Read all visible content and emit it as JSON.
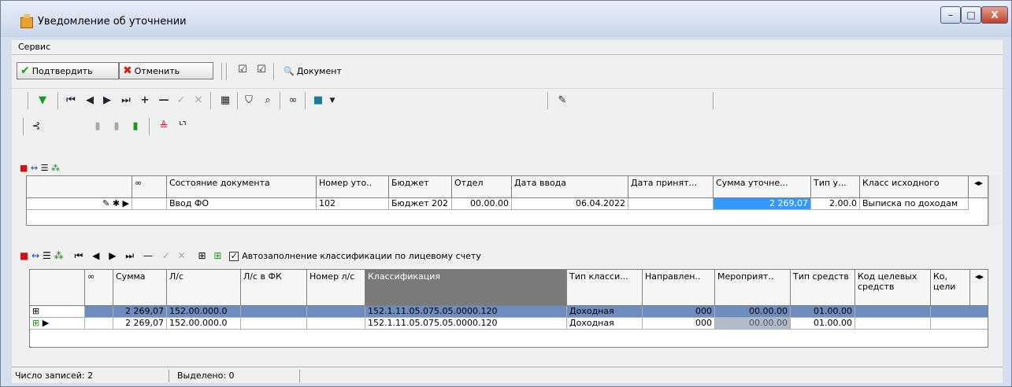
{
  "window": {
    "title": "Уведомление об уточнении",
    "minimize": "–",
    "restore": "□",
    "close": "X"
  },
  "menu": {
    "items": [
      "Сервис"
    ]
  },
  "toolbar1": {
    "confirm_label": "Подтвердить",
    "cancel_label": "Отменить",
    "document_label": "Документ"
  },
  "top_grid": {
    "columns": [
      "Состояние документа",
      "Номер уто..",
      "Бюджет",
      "Отдел",
      "Дата ввода",
      "Дата принят...",
      "Сумма уточне...",
      "Тип у...",
      "Класс исходного"
    ],
    "row": {
      "state": "Ввод ФО",
      "number": "102",
      "budget": "Бюджет 202",
      "dept": "00.00.00",
      "date_entry": "06.04.2022",
      "date_accept": "",
      "sum": "2 269,07",
      "type": "2.00.0",
      "class": "Выписка по доходам"
    }
  },
  "bottom_toolbar": {
    "autofill_label": "Автозаполнение классификации по лицевому счету",
    "autofill_checked": true
  },
  "bottom_grid": {
    "columns": [
      "Сумма",
      "Л/с",
      "Л/с в ФК",
      "Номер л/с",
      "Классификация",
      "Тип класси...",
      "Направлен..",
      "Мероприят..",
      "Тип средств",
      "Код целевых средств",
      "Ко, цели"
    ],
    "rows": [
      {
        "sum": "2 269,07",
        "ls": "152.00.000.0",
        "ls_fk": "",
        "num": "",
        "classif": "152.1.11.05.075.05.0000.120",
        "type": "Доходная",
        "dir": "000",
        "event": "00.00.00",
        "funds": "01.00.00",
        "code": ""
      },
      {
        "sum": "2 269,07",
        "ls": "152.00.000.0",
        "ls_fk": "",
        "num": "",
        "classif": "152.1.11.05.075.05.0000.120",
        "type": "Доходная",
        "dir": "000",
        "event": "00.00.00",
        "funds": "01.00.00",
        "code": ""
      }
    ]
  },
  "status": {
    "count_label": "Число записей:",
    "count_value": "2",
    "selected_label": "Выделено:",
    "selected_value": "0"
  },
  "colors": {
    "selected_row": "#6c8dbd",
    "selected_cell": "#3399ff",
    "event_cell": "#b0bccc"
  }
}
